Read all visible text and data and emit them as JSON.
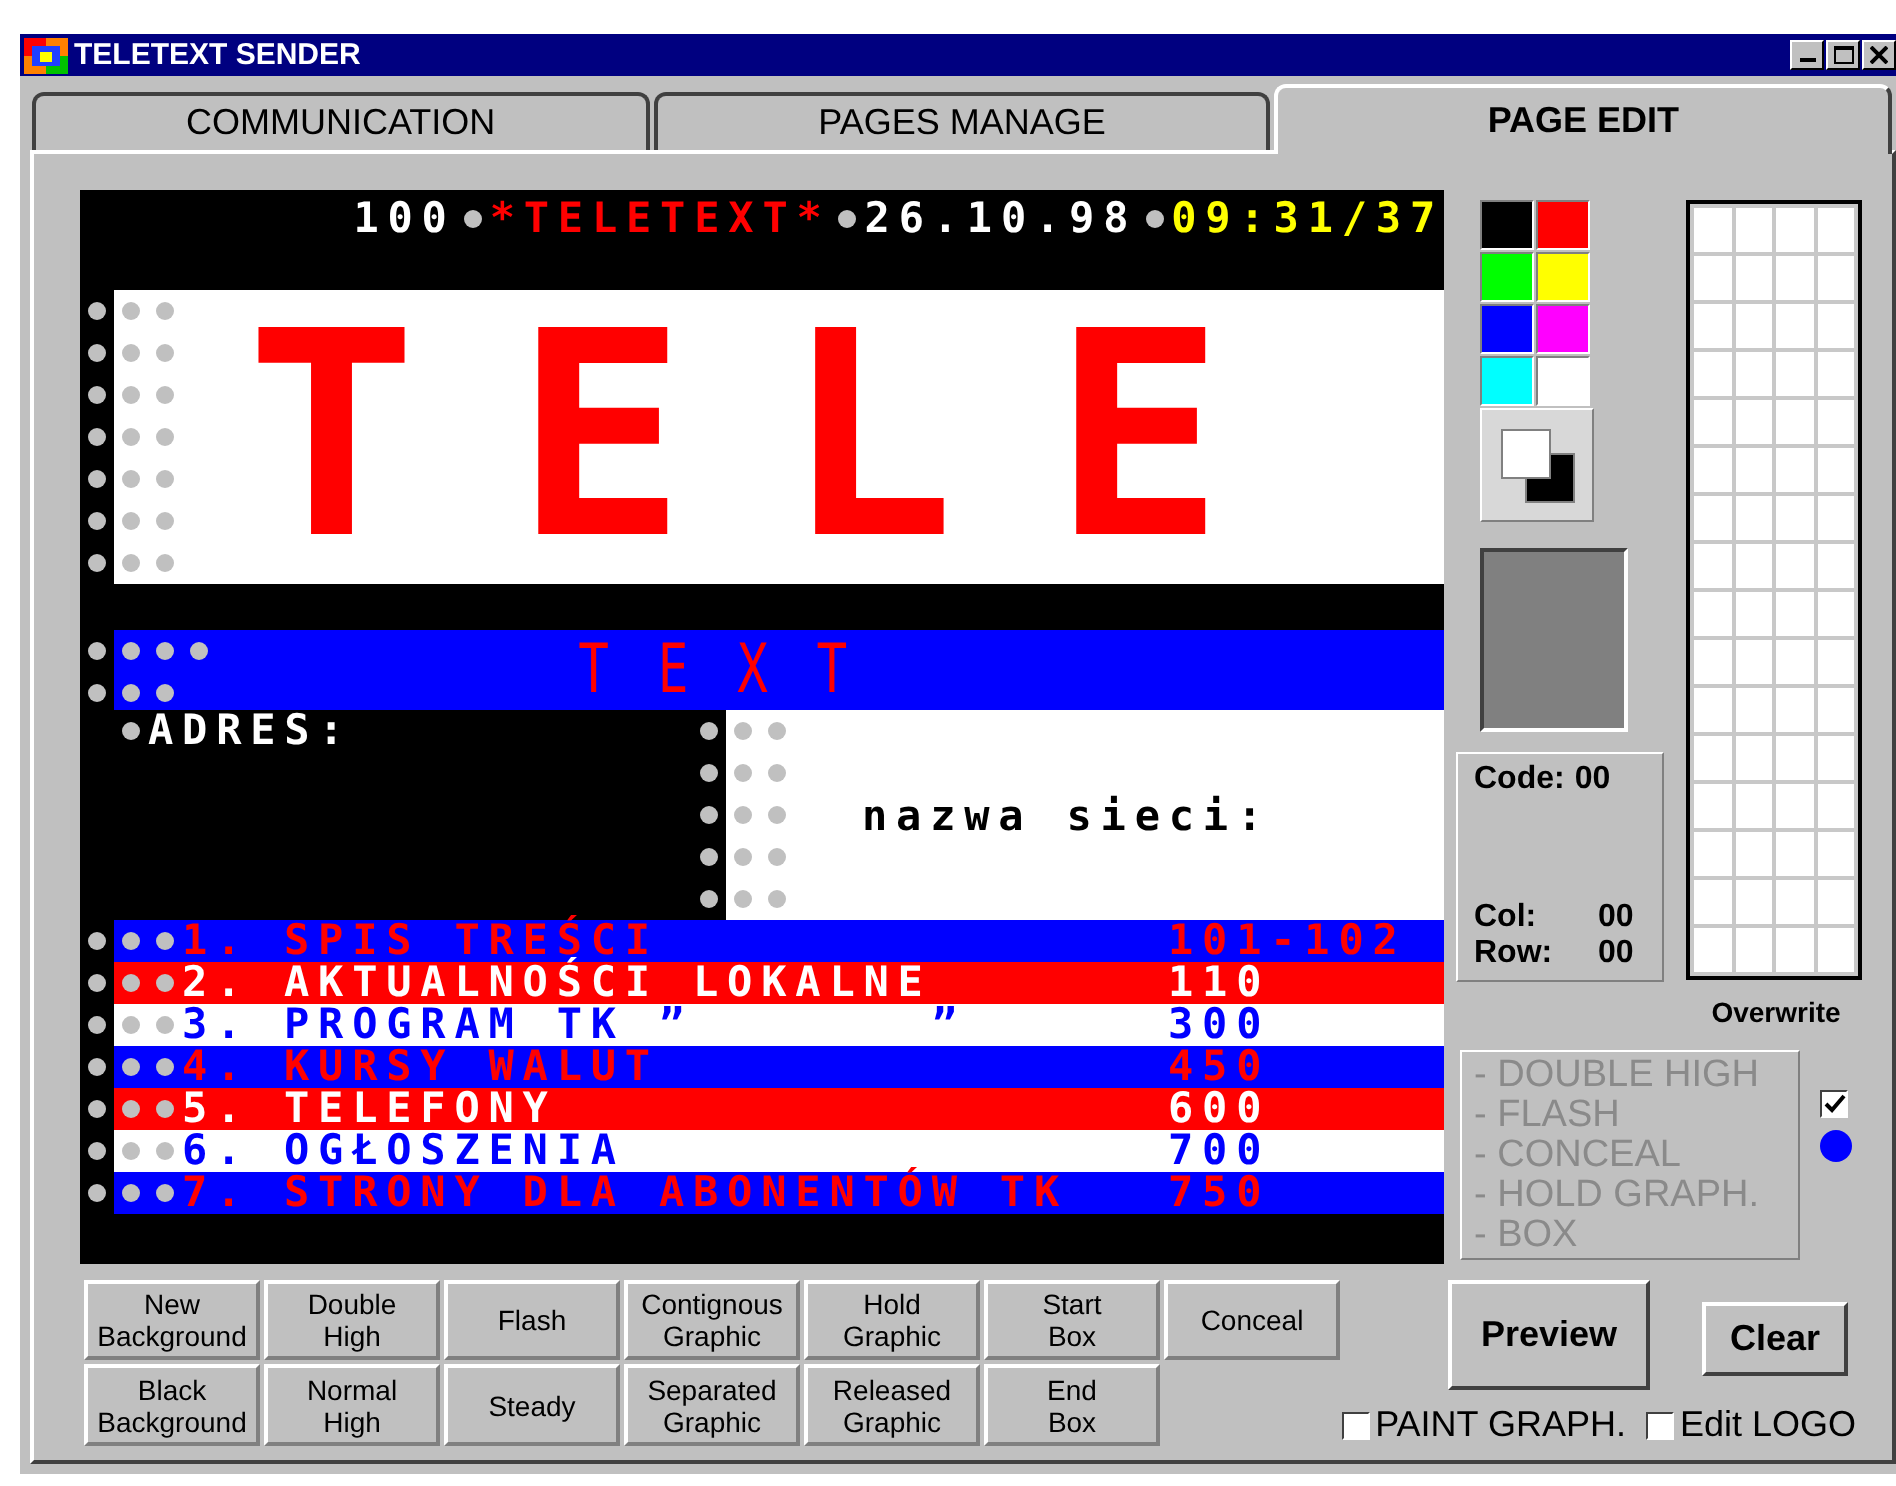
{
  "window": {
    "title": "TELETEXT SENDER"
  },
  "tabs": [
    {
      "label": "COMMUNICATION",
      "selected": false
    },
    {
      "label": "PAGES MANAGE",
      "selected": false
    },
    {
      "label": "PAGE EDIT",
      "selected": true
    }
  ],
  "teletext": {
    "header": [
      {
        "text": "100",
        "color": "#ffffff"
      },
      {
        "text": "*TELETEXT*",
        "color": "#ff0000"
      },
      {
        "text": "26.10.98",
        "color": "#ffffff"
      },
      {
        "text": "09:31/37",
        "color": "#ffff00"
      }
    ],
    "logo": "TELE",
    "banner": "T E X T",
    "address_label": "ADRES:",
    "network_label": "nazwa sieci:",
    "menu": [
      {
        "number": "1.",
        "title": "SPIS TREŚCI",
        "page": "101-102",
        "kind": "blue"
      },
      {
        "number": "2.",
        "title": "AKTUALNOŚCI LOKALNE",
        "page": "110",
        "kind": "red"
      },
      {
        "number": "3.",
        "title": "PROGRAM TK ”       ”",
        "page": "300",
        "kind": "white"
      },
      {
        "number": "4.",
        "title": "KURSY WALUT",
        "page": "450",
        "kind": "blue"
      },
      {
        "number": "5.",
        "title": "TELEFONY",
        "page": "600",
        "kind": "red"
      },
      {
        "number": "6.",
        "title": "OGŁOSZENIA",
        "page": "700",
        "kind": "white"
      },
      {
        "number": "7.",
        "title": "STRONY DLA ABONENTÓW TK",
        "page": "750",
        "kind": "blue"
      }
    ]
  },
  "palette": [
    {
      "color": "#000000"
    },
    {
      "color": "#ff0000"
    },
    {
      "color": "#00ff00"
    },
    {
      "color": "#ffff00"
    },
    {
      "color": "#0000ff"
    },
    {
      "color": "#ff00ff"
    },
    {
      "color": "#00ffff"
    },
    {
      "color": "#ffffff"
    }
  ],
  "info": {
    "code_label": "Code:",
    "code": "00",
    "col_label": "Col:",
    "col": "00",
    "row_label": "Row:",
    "row": "00"
  },
  "grid_label": "Overwrite",
  "attributes": [
    {
      "text": "- DOUBLE HIGH",
      "disabled": true
    },
    {
      "text": "- FLASH",
      "disabled": true
    },
    {
      "text": "- CONCEAL",
      "disabled": true
    },
    {
      "text": "- HOLD GRAPH.",
      "disabled": true
    },
    {
      "text": "- BOX",
      "disabled": true
    }
  ],
  "attribute_checkbox": {
    "checked": true
  },
  "indicator": {
    "on": true
  },
  "buttons": [
    [
      "New\nBackground",
      "Double\nHigh",
      "Flash",
      "Contignous\nGraphic",
      "Hold\nGraphic",
      "Start\nBox",
      "Conceal"
    ],
    [
      "Black\nBackground",
      "Normal\nHigh",
      "Steady",
      "Separated\nGraphic",
      "Released\nGraphic",
      "End\nBox"
    ]
  ],
  "actions": [
    "Preview",
    "Clear"
  ],
  "options": [
    {
      "label": "PAINT GRAPH.",
      "checked": false
    },
    {
      "label": "Edit LOGO",
      "checked": false
    }
  ]
}
